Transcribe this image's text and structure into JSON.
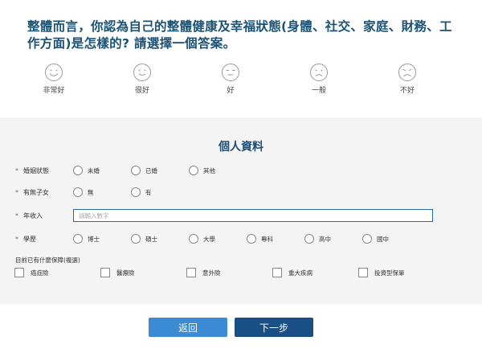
{
  "question": {
    "text": "整體而言，你認為自己的整體健康及幸福狀態(身體、社交、家庭、財務、工作方面)是怎樣的? 請選擇一個答案。",
    "options": [
      {
        "label": "非常好",
        "icon": "very-happy-face-icon"
      },
      {
        "label": "很好",
        "icon": "happy-face-icon"
      },
      {
        "label": "好",
        "icon": "neutral-face-icon"
      },
      {
        "label": "一般",
        "icon": "sad-face-icon"
      },
      {
        "label": "不好",
        "icon": "very-sad-face-icon"
      }
    ]
  },
  "profile": {
    "title": "個人資料",
    "marital": {
      "label": "婚姻狀態",
      "options": [
        "未婚",
        "已婚",
        "其他"
      ]
    },
    "children": {
      "label": "有無子女",
      "options": [
        "無",
        "有"
      ]
    },
    "income": {
      "label": "年收入",
      "placeholder": "請輸入數字"
    },
    "education": {
      "label": "學歷",
      "options": [
        "博士",
        "碩士",
        "大學",
        "專科",
        "高中",
        "國中"
      ]
    },
    "insurance": {
      "title": "目前已有什麼保障(複選)",
      "options": [
        "癌症險",
        "醫療險",
        "意外險",
        "重大疾病",
        "投資型保單"
      ]
    }
  },
  "buttons": {
    "back": "返回",
    "next": "下一步"
  },
  "colors": {
    "title_blue": "#1a5276",
    "back_button": "#3a8ad4",
    "next_button": "#1a4f86",
    "panel_bg": "#f4f4f4"
  }
}
